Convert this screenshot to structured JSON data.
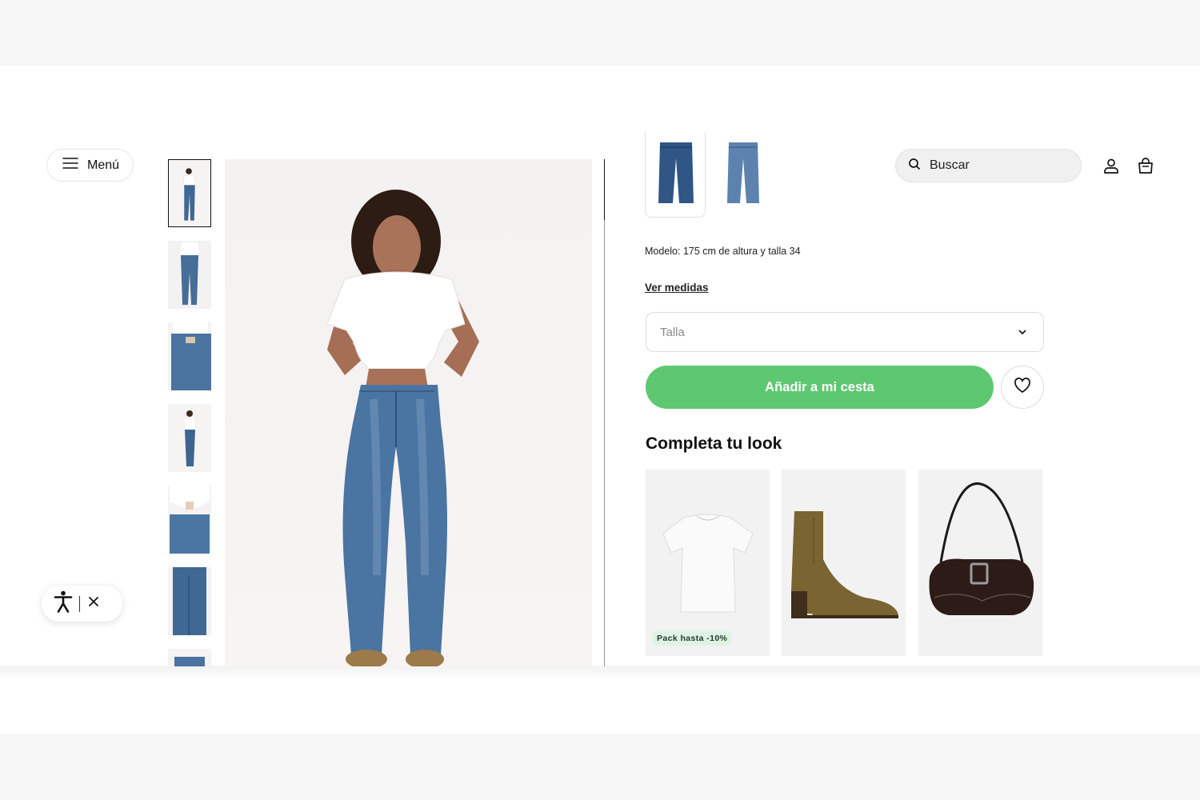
{
  "header": {
    "menu_label": "Menú",
    "search_placeholder": "Buscar",
    "account_icon": "user-icon",
    "cart_icon": "bag-icon"
  },
  "gallery": {
    "thumbnails": [
      {
        "view": "full-front",
        "selected": true
      },
      {
        "view": "full-back",
        "selected": false
      },
      {
        "view": "waist-back",
        "selected": false
      },
      {
        "view": "full-side",
        "selected": false
      },
      {
        "view": "waist-front",
        "selected": false
      },
      {
        "view": "legs-detail",
        "selected": false
      },
      {
        "view": "detail",
        "selected": false
      }
    ]
  },
  "product": {
    "color_variants": [
      {
        "color": "#2f5685",
        "selected": true
      },
      {
        "color": "#5d82ad",
        "selected": false
      }
    ],
    "model_info": "Modelo: 175 cm de altura y talla 34",
    "size_guide_link": "Ver medidas",
    "size_select_placeholder": "Talla",
    "add_to_cart_label": "Añadir a mi cesta",
    "accent_color": "#5ec871"
  },
  "complete_look": {
    "title": "Completa tu look",
    "items": [
      {
        "item": "white-tshirt",
        "badge": "Pack hasta -10%"
      },
      {
        "item": "suede-ankle-boot",
        "badge": ""
      },
      {
        "item": "black-shoulder-bag",
        "badge": ""
      }
    ]
  },
  "accessibility": {
    "icon": "accessibility-icon",
    "close_icon": "close-icon"
  }
}
